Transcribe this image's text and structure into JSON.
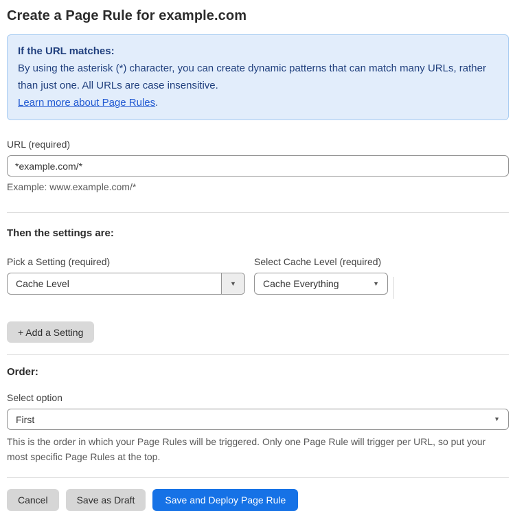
{
  "title": "Create a Page Rule for example.com",
  "info_box": {
    "heading": "If the URL matches:",
    "body": "By using the asterisk (*) character, you can create dynamic patterns that can match many URLs, rather than just one. All URLs are case insensitive.",
    "link_label": "Learn more about Page Rules",
    "link_suffix": "."
  },
  "url_field": {
    "label": "URL (required)",
    "value": "*example.com/*",
    "hint": "Example: www.example.com/*"
  },
  "settings_section": {
    "heading": "Then the settings are:",
    "setting_picker": {
      "label": "Pick a Setting (required)",
      "value": "Cache Level"
    },
    "cache_level_picker": {
      "label": "Select Cache Level (required)",
      "value": "Cache Everything"
    },
    "add_setting_label": "+ Add a Setting"
  },
  "order_section": {
    "heading": "Order:",
    "label": "Select option",
    "value": "First",
    "hint": "This is the order in which your Page Rules will be triggered. Only one Page Rule will trigger per URL, so put your most specific Page Rules at the top."
  },
  "footer": {
    "cancel_label": "Cancel",
    "save_draft_label": "Save as Draft",
    "save_deploy_label": "Save and Deploy Page Rule"
  },
  "icons": {
    "caret_down": "▼"
  },
  "colors": {
    "info_background": "#e2edfb",
    "info_border": "#a9cdf2",
    "info_text": "#21407e",
    "link_blue": "#2159d2",
    "primary_button_blue": "#1672e6",
    "gray_button": "#d6d6d6"
  }
}
